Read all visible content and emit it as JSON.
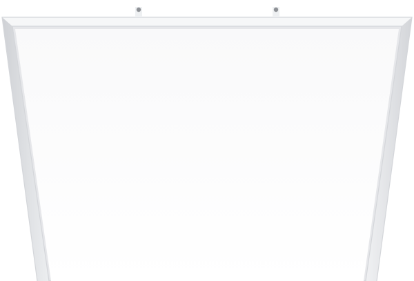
{
  "scene": {
    "subject": "ceiling-led-panel",
    "view": "angled-from-below",
    "colors": {
      "background": "#ffffff",
      "frame_outer": "#e6e7ea",
      "frame_edge": "#d4d6da",
      "frame_highlight": "#f6f7f8",
      "diffuser_top": "#f9f9fa",
      "diffuser_bottom": "#ffffff",
      "mount_screw": "#8e9196"
    },
    "visible_parts": [
      "frame-outer",
      "frame-inner-bevel",
      "diffuser-surface",
      "mount-screw-left",
      "mount-screw-right"
    ]
  }
}
